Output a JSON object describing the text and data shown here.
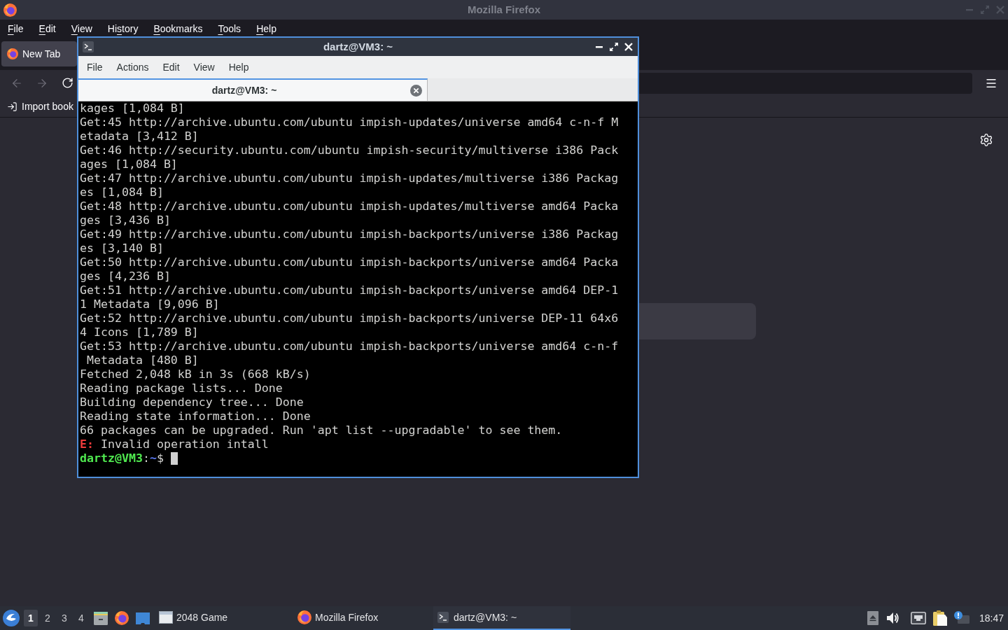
{
  "firefox": {
    "title": "Mozilla Firefox",
    "menu": [
      {
        "key": "F",
        "post": "ile"
      },
      {
        "key": "E",
        "post": "dit"
      },
      {
        "key": "V",
        "post": "iew"
      },
      {
        "pre": "Hi",
        "key": "s",
        "post": "tory"
      },
      {
        "key": "B",
        "post": "ookmarks"
      },
      {
        "key": "T",
        "post": "ools"
      },
      {
        "key": "H",
        "post": "elp"
      }
    ],
    "tabs": [
      {
        "label": "New Tab",
        "selected": true
      }
    ],
    "navigation": {
      "back": {
        "disabled": true
      },
      "forward": {
        "disabled": true
      },
      "reload": {
        "disabled": false
      }
    },
    "bookmarks_toolbar": [
      {
        "label": "Import book"
      }
    ]
  },
  "terminal": {
    "title": "dartz@VM3: ~",
    "menu": [
      "File",
      "Actions",
      "Edit",
      "View",
      "Help"
    ],
    "tabs": [
      {
        "label": "dartz@VM3: ~",
        "selected": true
      }
    ],
    "lines": [
      {
        "kind": "output",
        "text": "kages [1,084 B]"
      },
      {
        "kind": "output",
        "text": "Get:45 http://archive.ubuntu.com/ubuntu impish-updates/universe amd64 c-n-f M"
      },
      {
        "kind": "output",
        "text": "etadata [3,412 B]"
      },
      {
        "kind": "output",
        "text": "Get:46 http://security.ubuntu.com/ubuntu impish-security/multiverse i386 Pack"
      },
      {
        "kind": "output",
        "text": "ages [1,084 B]"
      },
      {
        "kind": "output",
        "text": "Get:47 http://archive.ubuntu.com/ubuntu impish-updates/multiverse i386 Packag"
      },
      {
        "kind": "output",
        "text": "es [1,084 B]"
      },
      {
        "kind": "output",
        "text": "Get:48 http://archive.ubuntu.com/ubuntu impish-updates/multiverse amd64 Packa"
      },
      {
        "kind": "output",
        "text": "ges [3,436 B]"
      },
      {
        "kind": "output",
        "text": "Get:49 http://archive.ubuntu.com/ubuntu impish-backports/universe i386 Packag"
      },
      {
        "kind": "output",
        "text": "es [3,140 B]"
      },
      {
        "kind": "output",
        "text": "Get:50 http://archive.ubuntu.com/ubuntu impish-backports/universe amd64 Packa"
      },
      {
        "kind": "output",
        "text": "ges [4,236 B]"
      },
      {
        "kind": "output",
        "text": "Get:51 http://archive.ubuntu.com/ubuntu impish-backports/universe amd64 DEP-1"
      },
      {
        "kind": "output",
        "text": "1 Metadata [9,096 B]"
      },
      {
        "kind": "output",
        "text": "Get:52 http://archive.ubuntu.com/ubuntu impish-backports/universe DEP-11 64x6"
      },
      {
        "kind": "output",
        "text": "4 Icons [1,789 B]"
      },
      {
        "kind": "output",
        "text": "Get:53 http://archive.ubuntu.com/ubuntu impish-backports/universe amd64 c-n-f"
      },
      {
        "kind": "output",
        "text": " Metadata [480 B]"
      },
      {
        "kind": "output",
        "text": "Fetched 2,048 kB in 3s (668 kB/s)"
      },
      {
        "kind": "output",
        "text": "Reading package lists... Done"
      },
      {
        "kind": "output",
        "text": "Building dependency tree... Done"
      },
      {
        "kind": "output",
        "text": "Reading state information... Done"
      },
      {
        "kind": "output",
        "text": "66 packages can be upgraded. Run 'apt list --upgradable' to see them."
      },
      {
        "kind": "error",
        "prefix": "E:",
        "text": "Invalid operation intall"
      },
      {
        "kind": "prompt",
        "user_host": "dartz@VM3",
        "separator": ":",
        "path": "~",
        "symbol": "$",
        "cursor": true
      }
    ]
  },
  "taskbar": {
    "workspaces": [
      {
        "label": "1",
        "selected": true
      },
      {
        "label": "2",
        "selected": false
      },
      {
        "label": "3",
        "selected": false
      },
      {
        "label": "4",
        "selected": false
      }
    ],
    "tasks": [
      {
        "kind": "game",
        "label": "2048 Game",
        "selected": false
      },
      {
        "kind": "browser",
        "label": "Mozilla Firefox",
        "selected": false
      },
      {
        "kind": "terminal",
        "label": "dartz@VM3: ~",
        "selected": true
      }
    ],
    "clock": "18:47"
  }
}
